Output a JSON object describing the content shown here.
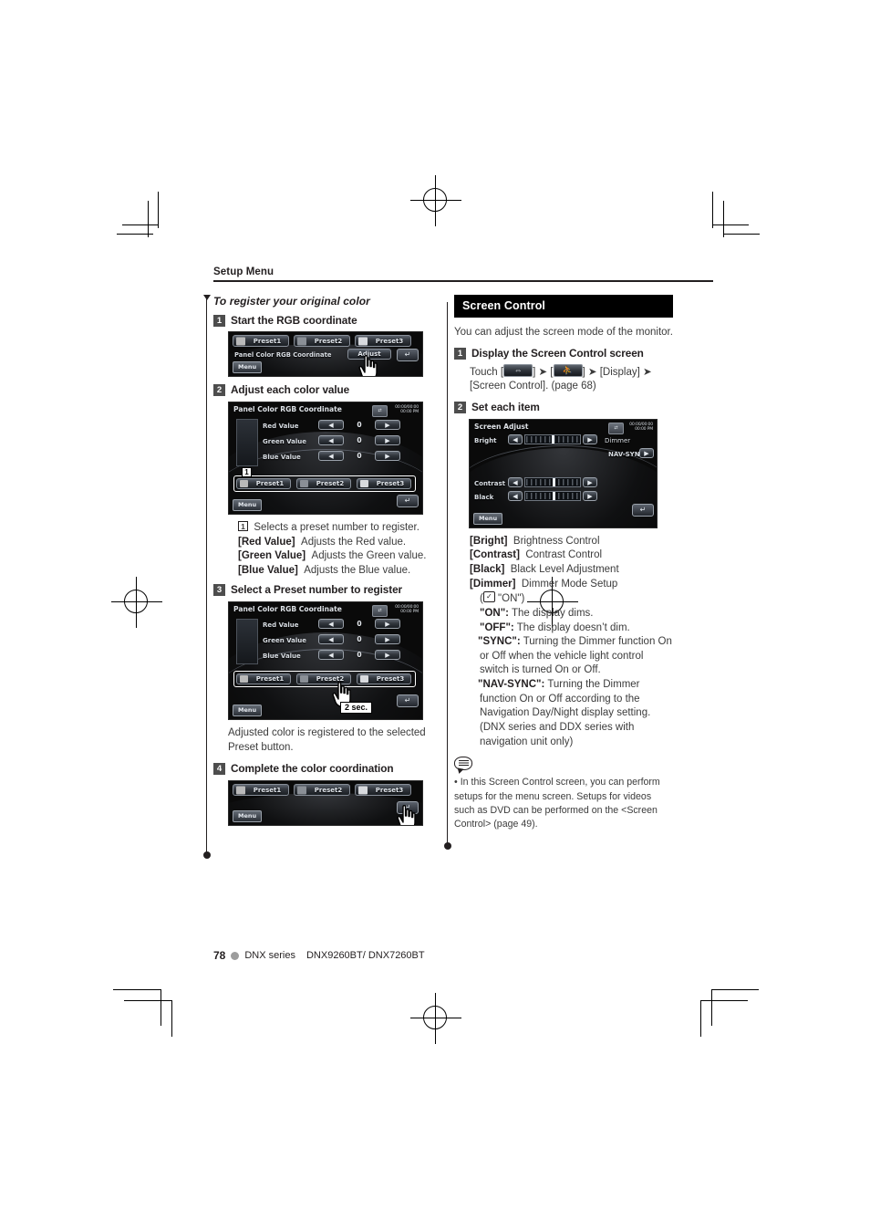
{
  "running_head": "Setup Menu",
  "footer": {
    "page_number": "78",
    "series": "DNX series",
    "models": "DNX9260BT/ DNX7260BT"
  },
  "left_column": {
    "subhead": "To register your original color",
    "steps": [
      {
        "num": "1",
        "title": "Start the RGB coordinate"
      },
      {
        "num": "2",
        "title": "Adjust each color value"
      },
      {
        "num": "3",
        "title": "Select a Preset number to register"
      },
      {
        "num": "4",
        "title": "Complete the color coordination"
      }
    ],
    "callout_list": [
      {
        "key": "1",
        "key_type": "boxed-number",
        "desc": "Selects a preset number to register."
      },
      {
        "key": "[Red Value]",
        "key_type": "bold",
        "desc": "Adjusts the Red value."
      },
      {
        "key": "[Green Value]",
        "key_type": "bold",
        "desc": "Adjusts the Green value."
      },
      {
        "key": "[Blue Value]",
        "key_type": "bold",
        "desc": "Adjusts the Blue value."
      }
    ],
    "after_step3_text": "Adjusted color is registered to the selected Preset button."
  },
  "device_screens": {
    "panel_color_title": "Panel Color RGB Coordinate",
    "clock": "00:00/00:00 00:00 PM",
    "clock_line1": "00:00/00:00",
    "clock_line2": "00:00 PM",
    "menu_label": "Menu",
    "adjust_label": "Adjust",
    "presets": [
      {
        "label": "Preset1",
        "color": "#b9b9b9"
      },
      {
        "label": "Preset2",
        "color": "#8a8f96"
      },
      {
        "label": "Preset3",
        "color": "#d8dade"
      }
    ],
    "rgb_rows": [
      {
        "label": "Red Value",
        "value": "0"
      },
      {
        "label": "Green Value",
        "value": "0"
      },
      {
        "label": "Blue Value",
        "value": "0"
      }
    ],
    "hold_badge": "2 sec.",
    "callout_badge": "1",
    "screen_adjust": {
      "title": "Screen Adjust",
      "rows": [
        {
          "label": "Bright",
          "knob_pct": 48
        },
        {
          "label": "Contrast",
          "knob_pct": 50
        },
        {
          "label": "Black",
          "knob_pct": 50
        }
      ],
      "dimmer_label": "Dimmer",
      "dimmer_value": "NAV-SYNC"
    }
  },
  "right_column": {
    "section_title": "Screen Control",
    "intro": "You can adjust the screen mode of the monitor.",
    "steps": [
      {
        "num": "1",
        "title": "Display the Screen Control screen"
      },
      {
        "num": "2",
        "title": "Set each item"
      }
    ],
    "touch_line": {
      "prefix": "Touch [",
      "mid1": "] ➤ [",
      "mid2": "] ➤ [Display] ➤",
      "tail": "[Screen Control]. (page 68)",
      "icon1_name": "source-switch-icon",
      "icon2_name": "setup-person-icon"
    },
    "item_list": [
      {
        "key": "[Bright]",
        "desc": "Brightness Control"
      },
      {
        "key": "[Contrast]",
        "desc": "Contrast Control"
      },
      {
        "key": "[Black]",
        "desc": "Black Level Adjustment"
      },
      {
        "key": "[Dimmer]",
        "desc": "Dimmer Mode Setup"
      }
    ],
    "dimmer_default": "(☑ \"ON\")",
    "dimmer_default_quote": "\"ON\")",
    "dimmer_options": [
      {
        "name": "\"ON\":",
        "desc": "The display dims."
      },
      {
        "name": "\"OFF\":",
        "desc": "The display doesn’t dim."
      },
      {
        "name": "\"SYNC\":",
        "desc": "Turning the Dimmer function On or Off when the vehicle light control switch is turned On or Off."
      },
      {
        "name": "\"NAV-SYNC\":",
        "desc": "Turning the Dimmer function On or Off according to the Navigation Day/Night display setting. (DNX series and DDX series with navigation unit only)"
      }
    ],
    "note": {
      "icon_name": "note-bubble-icon",
      "bullet": "•",
      "text": "In this Screen Control screen, you can perform setups for the menu screen. Setups for videos such as DVD can be performed on the <Screen Control> (page 49)."
    }
  }
}
